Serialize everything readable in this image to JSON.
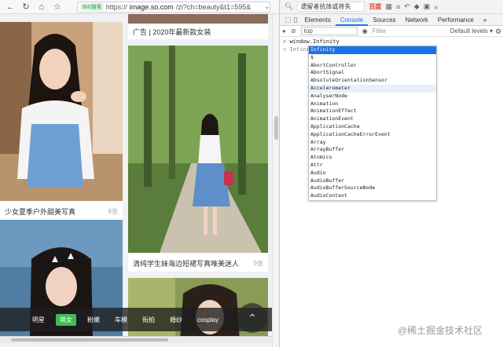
{
  "browser": {
    "search_badge": "360搜索",
    "url_prefix": "https://",
    "url_host": "image.so.com",
    "url_rest": "/zi?ch=beauty&t1=595&",
    "icons": [
      "back-icon",
      "refresh-icon",
      "home-icon",
      "star-icon"
    ]
  },
  "page": {
    "cards": [
      {
        "caption": "广告 | 2020年最新款女装",
        "count": ""
      },
      {
        "caption": "少女夏季户外甜美写真",
        "count": "8张"
      },
      {
        "caption": "清纯学生妹海边短裙写真唯美迷人",
        "count": "9张"
      }
    ],
    "tags": [
      "明星",
      "萌女",
      "粉嫩",
      "车模",
      "街拍",
      "婚纱",
      "cosplay"
    ],
    "active_tag_index": 1
  },
  "devtools": {
    "toolbar": {
      "search": "遗留者抗体或将失",
      "hot": "百度",
      "more": "»"
    },
    "tabs": [
      "Elements",
      "Console",
      "Sources",
      "Network",
      "Performance",
      "»"
    ],
    "active_tab": "Console",
    "console_bar": {
      "context": "top",
      "filter_placeholder": "Filter",
      "levels": "Default levels ▾"
    },
    "lines": [
      {
        "prompt": ">",
        "text": "window.Infinity"
      },
      {
        "prompt": "<",
        "text": "Infinity"
      }
    ],
    "autocomplete": [
      "Infinity",
      "$",
      "AbortController",
      "AbortSignal",
      "AbsoluteOrientationSensor",
      "Accelerometer",
      "AnalyserNode",
      "Animation",
      "AnimationEffect",
      "AnimationEvent",
      "ApplicationCache",
      "ApplicationCacheErrorEvent",
      "Array",
      "ArrayBuffer",
      "Atomics",
      "Attr",
      "Audio",
      "AudioBuffer",
      "AudioBufferSourceNode",
      "AudioContext"
    ],
    "selected_index": 0,
    "hovered_index": 5
  },
  "watermark": "@稀土掘金技术社区",
  "colors": {
    "accent": "#1a73e8",
    "tag_active": "#3dbc52",
    "hot": "#e3402d"
  }
}
